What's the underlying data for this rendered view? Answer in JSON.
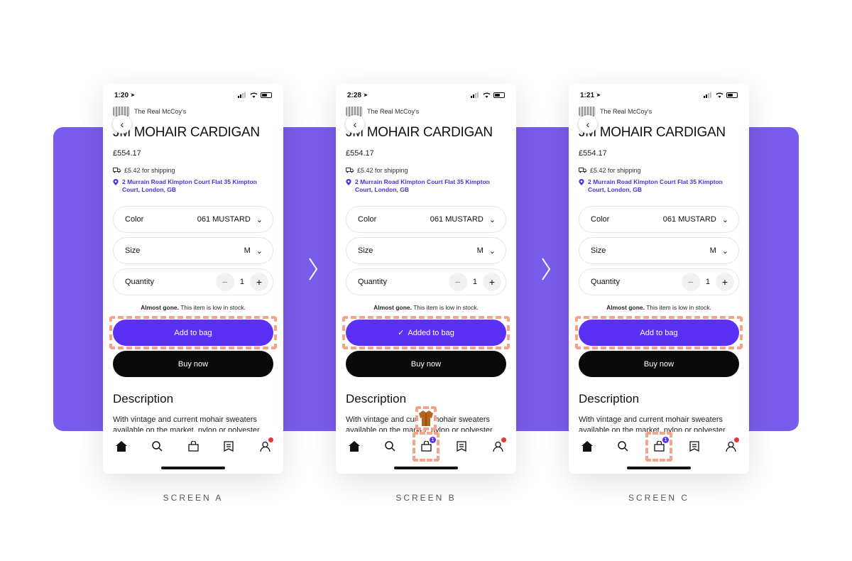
{
  "screens": [
    {
      "time": "1:20",
      "brand": "The Real McCoy's",
      "title": "JM MOHAIR CARDIGAN",
      "price": "£554.17",
      "shipping": "£5.42 for shipping",
      "address": "2 Murrain Road Kimpton Court Flat 35 Kimpton Court, London, GB",
      "color_label": "Color",
      "color_value": "061 MUSTARD",
      "size_label": "Size",
      "size_value": "M",
      "quantity_label": "Quantity",
      "quantity_value": "1",
      "stock_bold": "Almost gone.",
      "stock_text": "This item is low in stock.",
      "primary_button": "Add to bag",
      "buy_button": "Buy now",
      "description_heading": "Description",
      "description_text": "With vintage and current mohair sweaters available on the market, nylon or polyester",
      "bag_count": "",
      "caption": "SCREEN A"
    },
    {
      "time": "2:28",
      "brand": "The Real McCoy's",
      "title": "JM MOHAIR CARDIGAN",
      "price": "£554.17",
      "shipping": "£5.42 for shipping",
      "address": "2 Murrain Road Kimpton Court Flat 35 Kimpton Court, London, GB",
      "color_label": "Color",
      "color_value": "061 MUSTARD",
      "size_label": "Size",
      "size_value": "M",
      "quantity_label": "Quantity",
      "quantity_value": "1",
      "stock_bold": "Almost gone.",
      "stock_text": "This item is low in stock.",
      "primary_button": "Added to bag",
      "buy_button": "Buy now",
      "description_heading": "Description",
      "description_text": "With vintage and current mohair sweaters available on the market, nylon or polyester",
      "bag_count": "1",
      "caption": "SCREEN B"
    },
    {
      "time": "1:21",
      "brand": "The Real McCoy's",
      "title": "JM MOHAIR CARDIGAN",
      "price": "£554.17",
      "shipping": "£5.42 for shipping",
      "address": "2 Murrain Road Kimpton Court Flat 35 Kimpton Court, London, GB",
      "color_label": "Color",
      "color_value": "061 MUSTARD",
      "size_label": "Size",
      "size_value": "M",
      "quantity_label": "Quantity",
      "quantity_value": "1",
      "stock_bold": "Almost gone.",
      "stock_text": "This item is low in stock.",
      "primary_button": "Add to bag",
      "buy_button": "Buy now",
      "description_heading": "Description",
      "description_text": "With vintage and current mohair sweaters available on the market, nylon or polyester",
      "bag_count": "1",
      "caption": "SCREEN C"
    }
  ],
  "colors": {
    "band": "#7a5cec",
    "accent": "#5a31f4",
    "highlight": "#f4a38a",
    "buy": "#0a0a0a"
  },
  "icons": [
    "chevron-left-icon",
    "truck-icon",
    "location-pin-icon",
    "chevron-down-icon",
    "minus-icon",
    "plus-icon",
    "checkmark-icon",
    "home-icon",
    "search-icon",
    "bag-icon",
    "orders-icon",
    "profile-icon",
    "chevron-right-icon"
  ]
}
